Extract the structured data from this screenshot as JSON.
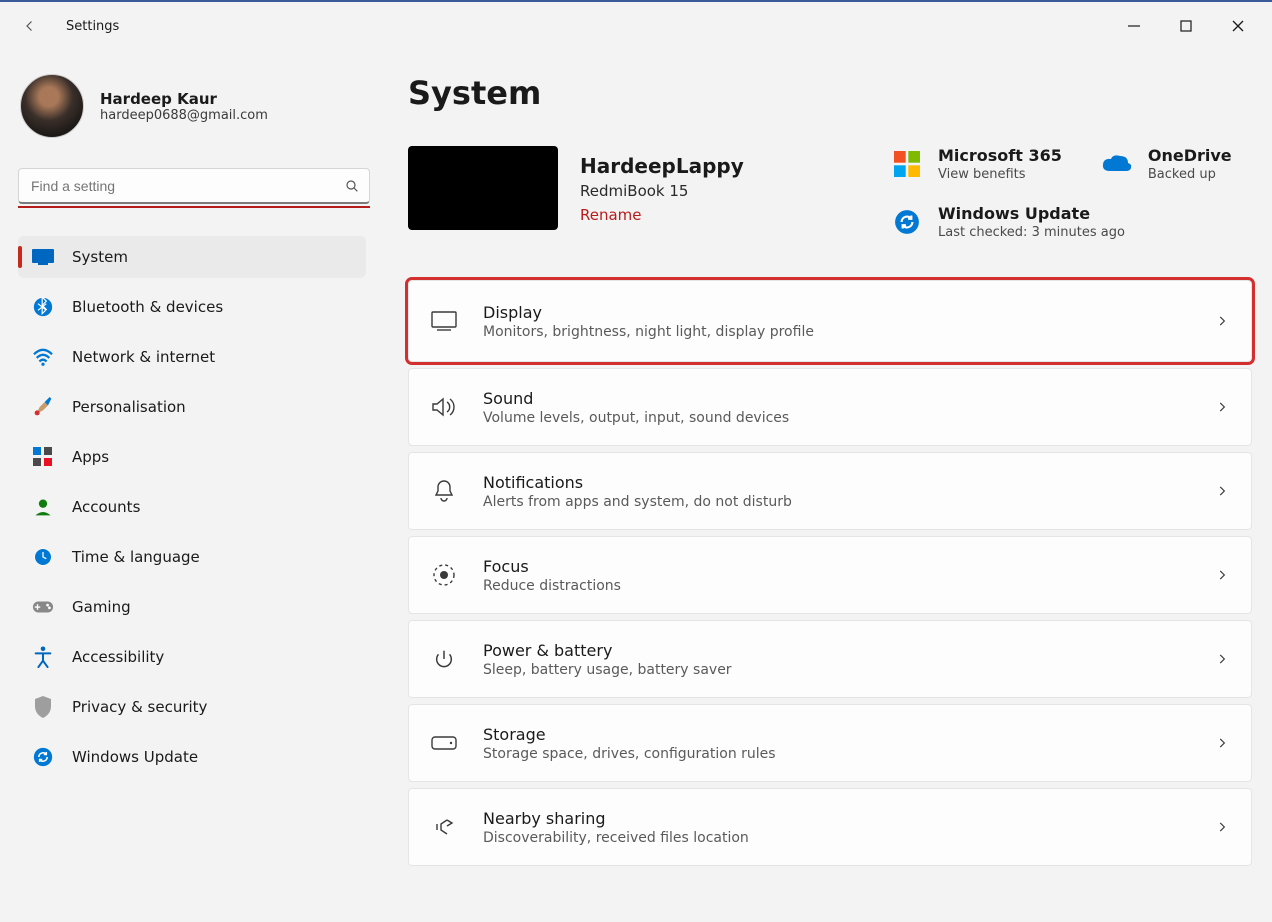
{
  "app": {
    "title": "Settings"
  },
  "user": {
    "name": "Hardeep Kaur",
    "email": "hardeep0688@gmail.com"
  },
  "search": {
    "placeholder": "Find a setting"
  },
  "nav": [
    {
      "id": "system",
      "label": "System"
    },
    {
      "id": "bluetooth",
      "label": "Bluetooth & devices"
    },
    {
      "id": "network",
      "label": "Network & internet"
    },
    {
      "id": "personalisation",
      "label": "Personalisation"
    },
    {
      "id": "apps",
      "label": "Apps"
    },
    {
      "id": "accounts",
      "label": "Accounts"
    },
    {
      "id": "time",
      "label": "Time & language"
    },
    {
      "id": "gaming",
      "label": "Gaming"
    },
    {
      "id": "accessibility",
      "label": "Accessibility"
    },
    {
      "id": "privacy",
      "label": "Privacy & security"
    },
    {
      "id": "update",
      "label": "Windows Update"
    }
  ],
  "page": {
    "title": "System"
  },
  "device": {
    "name": "HardeepLappy",
    "model": "RedmiBook 15",
    "rename": "Rename"
  },
  "services": {
    "m365": {
      "title": "Microsoft 365",
      "sub": "View benefits"
    },
    "onedrive": {
      "title": "OneDrive",
      "sub": "Backed up"
    },
    "update": {
      "title": "Windows Update",
      "sub": "Last checked: 3 minutes ago"
    }
  },
  "cards": [
    {
      "id": "display",
      "title": "Display",
      "sub": "Monitors, brightness, night light, display profile",
      "highlight": true
    },
    {
      "id": "sound",
      "title": "Sound",
      "sub": "Volume levels, output, input, sound devices"
    },
    {
      "id": "notifications",
      "title": "Notifications",
      "sub": "Alerts from apps and system, do not disturb"
    },
    {
      "id": "focus",
      "title": "Focus",
      "sub": "Reduce distractions"
    },
    {
      "id": "power",
      "title": "Power & battery",
      "sub": "Sleep, battery usage, battery saver"
    },
    {
      "id": "storage",
      "title": "Storage",
      "sub": "Storage space, drives, configuration rules"
    },
    {
      "id": "nearby",
      "title": "Nearby sharing",
      "sub": "Discoverability, received files location"
    }
  ]
}
